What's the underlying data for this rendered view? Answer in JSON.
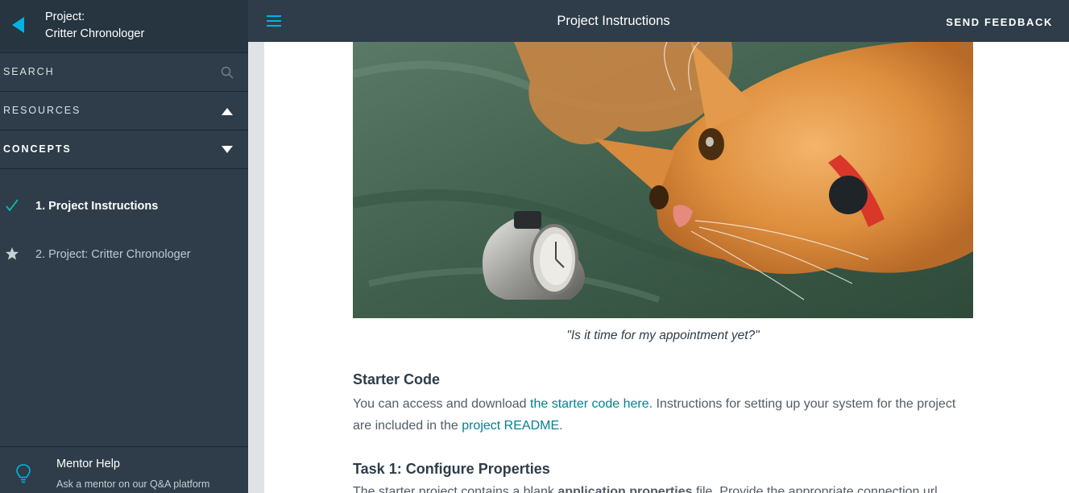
{
  "sidebar": {
    "project_line1": "Project:",
    "project_line2": "Critter Chronologer",
    "search_label": "SEARCH",
    "resources_label": "RESOURCES",
    "concepts_label": "CONCEPTS",
    "concepts": [
      {
        "label": "1. Project Instructions",
        "status": "completed"
      },
      {
        "label": "2. Project: Critter Chronologer",
        "status": "project"
      }
    ],
    "mentor": {
      "title": "Mentor Help",
      "subtitle": "Ask a mentor on our Q&A platform"
    }
  },
  "topbar": {
    "title": "Project Instructions",
    "feedback_label": "SEND FEEDBACK"
  },
  "content": {
    "caption": "\"Is it time for my appointment yet?\"",
    "starter_heading": "Starter Code",
    "starter_text_1": "You can access and download ",
    "starter_link_1": "the starter code here",
    "starter_text_2": ". Instructions for setting up your system for the project are included in the ",
    "starter_link_2": "project README",
    "starter_text_3": ".",
    "task1_heading": "Task 1: Configure Properties",
    "task1_text_1": "The starter project contains a blank ",
    "task1_bold": "application.properties",
    "task1_text_2": " file. Provide the appropriate connection url"
  },
  "colors": {
    "sidebar_bg": "#2e3d49",
    "accent": "#02b3e4",
    "link": "#02828e",
    "check": "#02ccba"
  }
}
